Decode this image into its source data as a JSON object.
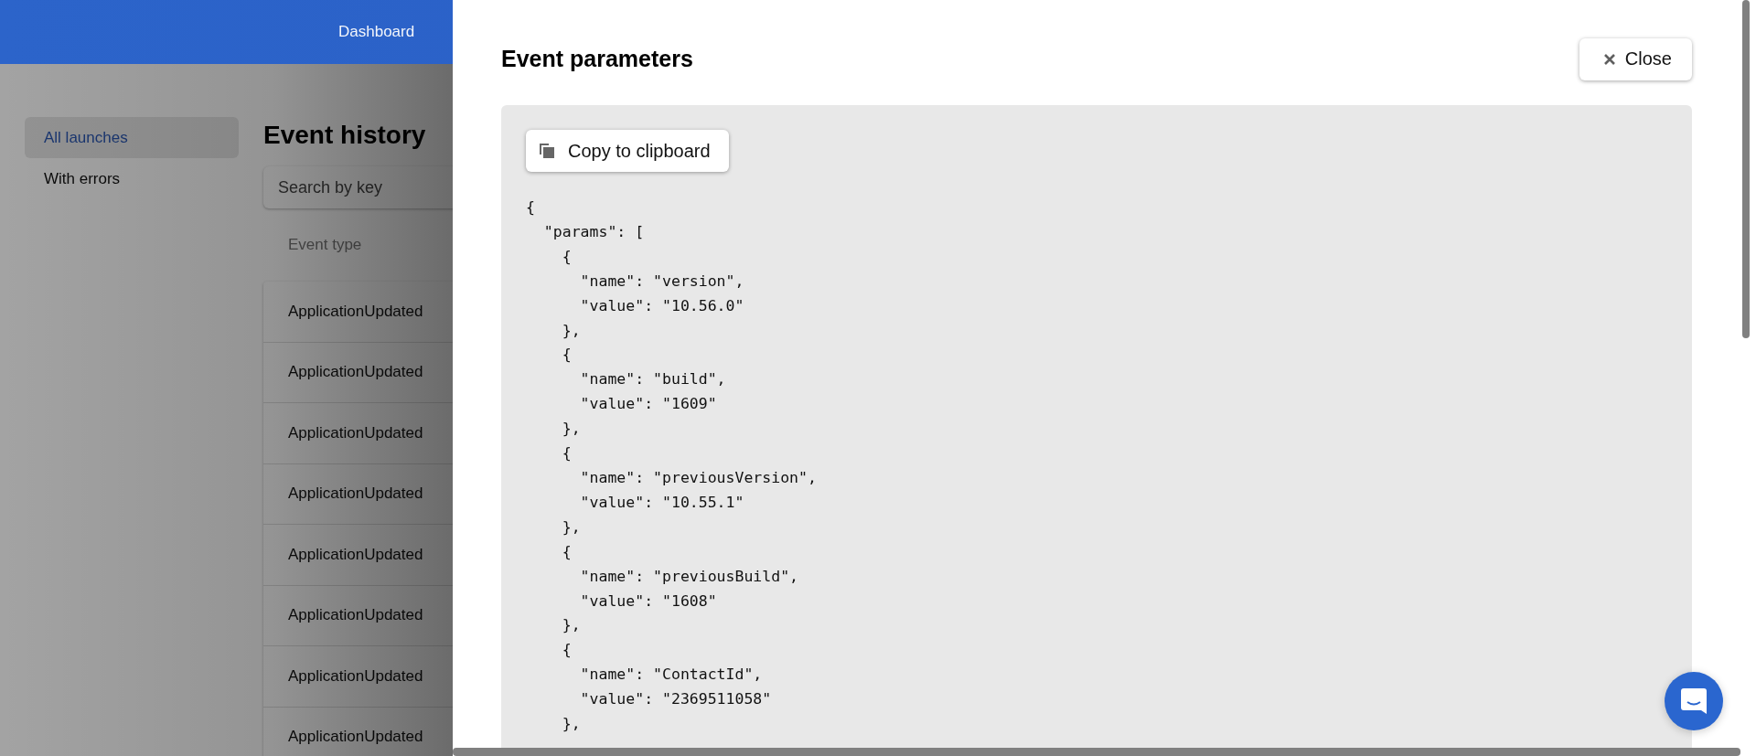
{
  "header": {
    "nav": [
      {
        "label": "Dashboard"
      }
    ]
  },
  "sidebar": {
    "items": [
      {
        "label": "All launches",
        "selected": true
      },
      {
        "label": "With errors",
        "selected": false
      }
    ]
  },
  "main": {
    "title": "Event history",
    "search": {
      "placeholder": "Search by key"
    },
    "table": {
      "columns": [
        "Event type"
      ],
      "rows": [
        {
          "event_type": "ApplicationUpdated"
        },
        {
          "event_type": "ApplicationUpdated"
        },
        {
          "event_type": "ApplicationUpdated"
        },
        {
          "event_type": "ApplicationUpdated"
        },
        {
          "event_type": "ApplicationUpdated"
        },
        {
          "event_type": "ApplicationUpdated"
        },
        {
          "event_type": "ApplicationUpdated"
        },
        {
          "event_type": "ApplicationUpdated"
        }
      ]
    }
  },
  "drawer": {
    "title": "Event parameters",
    "close_button": "Close",
    "copy_button": "Copy to clipboard",
    "code_lines": [
      "{",
      "  \"params\": [",
      "    {",
      "      \"name\": \"version\",",
      "      \"value\": \"10.56.0\"",
      "    },",
      "    {",
      "      \"name\": \"build\",",
      "      \"value\": \"1609\"",
      "    },",
      "    {",
      "      \"name\": \"previousVersion\",",
      "      \"value\": \"10.55.1\"",
      "    },",
      "    {",
      "      \"name\": \"previousBuild\",",
      "      \"value\": \"1608\"",
      "    },",
      "    {",
      "      \"name\": \"ContactId\",",
      "      \"value\": \"2369511058\"",
      "    },"
    ]
  }
}
